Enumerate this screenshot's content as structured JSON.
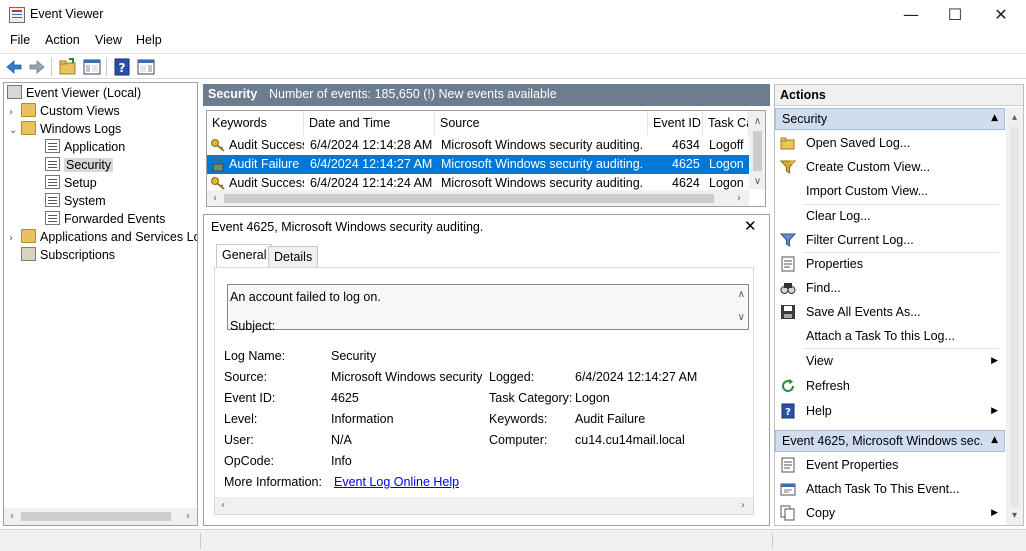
{
  "window": {
    "title": "Event Viewer",
    "controls": {
      "minimize": "—",
      "maximize": "☐",
      "close": "✕"
    }
  },
  "menu": [
    "File",
    "Action",
    "View",
    "Help"
  ],
  "toolbar": {
    "icons": [
      "back-icon",
      "forward-icon",
      "open-folder-icon",
      "show-hide-tree-icon",
      "help-icon",
      "show-hide-actions-icon"
    ]
  },
  "tree": {
    "items": [
      {
        "label": "Event Viewer (Local)",
        "expander": "",
        "icon": "event-viewer-icon"
      },
      {
        "label": "Custom Views",
        "expander": "›",
        "icon": "folder-icon"
      },
      {
        "label": "Windows Logs",
        "expander": "⌄",
        "icon": "folder-icon"
      },
      {
        "label": "Application",
        "expander": "",
        "icon": "log-icon"
      },
      {
        "label": "Security",
        "expander": "",
        "icon": "log-icon"
      },
      {
        "label": "Setup",
        "expander": "",
        "icon": "log-icon"
      },
      {
        "label": "System",
        "expander": "",
        "icon": "log-icon"
      },
      {
        "label": "Forwarded Events",
        "expander": "",
        "icon": "log-icon"
      },
      {
        "label": "Applications and Services Lo",
        "expander": "›",
        "icon": "folder-icon"
      },
      {
        "label": "Subscriptions",
        "expander": "",
        "icon": "subscriptions-icon"
      }
    ],
    "selected_index": 4
  },
  "log_header": {
    "title": "Security",
    "summary": "Number of events: 185,650 (!) New events available"
  },
  "events_table": {
    "columns": [
      "Keywords",
      "Date and Time",
      "Source",
      "Event ID",
      "Task Ca"
    ],
    "rows": [
      {
        "keywords": "Audit Success",
        "datetime": "6/4/2024 12:14:28 AM",
        "source": "Microsoft Windows security auditing.",
        "event_id": "4634",
        "task": "Logoff",
        "icon": "key-icon",
        "selected": false
      },
      {
        "keywords": "Audit Failure",
        "datetime": "6/4/2024 12:14:27 AM",
        "source": "Microsoft Windows security auditing.",
        "event_id": "4625",
        "task": "Logon",
        "icon": "lock-icon",
        "selected": true
      },
      {
        "keywords": "Audit Success",
        "datetime": "6/4/2024 12:14:24 AM",
        "source": "Microsoft Windows security auditing.",
        "event_id": "4624",
        "task": "Logon",
        "icon": "key-icon",
        "selected": false
      }
    ]
  },
  "event_detail": {
    "title": "Event 4625, Microsoft Windows security auditing.",
    "close": "✕",
    "tabs": [
      "General",
      "Details"
    ],
    "description_line1": "An account failed to log on.",
    "description_line2": "Subject:",
    "props": {
      "log_name_label": "Log Name:",
      "log_name": "Security",
      "source_label": "Source:",
      "source": "Microsoft Windows security",
      "logged_label": "Logged:",
      "logged": "6/4/2024 12:14:27 AM",
      "event_id_label": "Event ID:",
      "event_id": "4625",
      "task_label": "Task Category:",
      "task": "Logon",
      "level_label": "Level:",
      "level": "Information",
      "keywords_label": "Keywords:",
      "keywords": "Audit Failure",
      "user_label": "User:",
      "user": "N/A",
      "computer_label": "Computer:",
      "computer": "cu14.cu14mail.local",
      "opcode_label": "OpCode:",
      "opcode": "Info",
      "more_info_label": "More Information:",
      "more_info_link": "Event Log Online Help"
    }
  },
  "actions": {
    "title": "Actions",
    "section1": {
      "header": "Security",
      "items": [
        {
          "label": "Open Saved Log...",
          "icon": "open-log-icon"
        },
        {
          "label": "Create Custom View...",
          "icon": "filter-create-icon"
        },
        {
          "label": "Import Custom View...",
          "icon": ""
        },
        {
          "label": "Clear Log...",
          "icon": ""
        },
        {
          "label": "Filter Current Log...",
          "icon": "filter-icon"
        },
        {
          "label": "Properties",
          "icon": "properties-icon"
        },
        {
          "label": "Find...",
          "icon": "find-icon"
        },
        {
          "label": "Save All Events As...",
          "icon": "save-icon"
        },
        {
          "label": "Attach a Task To this Log...",
          "icon": ""
        },
        {
          "label": "View",
          "icon": "",
          "submenu": true
        },
        {
          "label": "Refresh",
          "icon": "refresh-icon"
        },
        {
          "label": "Help",
          "icon": "help-icon",
          "submenu": true
        }
      ]
    },
    "section2": {
      "header": "Event 4625, Microsoft Windows sec...",
      "items": [
        {
          "label": "Event Properties",
          "icon": "event-properties-icon"
        },
        {
          "label": "Attach Task To This Event...",
          "icon": "attach-task-icon"
        },
        {
          "label": "Copy",
          "icon": "copy-icon",
          "submenu": true
        }
      ]
    }
  },
  "colors": {
    "selection": "#0078d7",
    "header_bar": "#6b7d8e",
    "section_header": "#cfddef",
    "link": "#0000ee"
  }
}
